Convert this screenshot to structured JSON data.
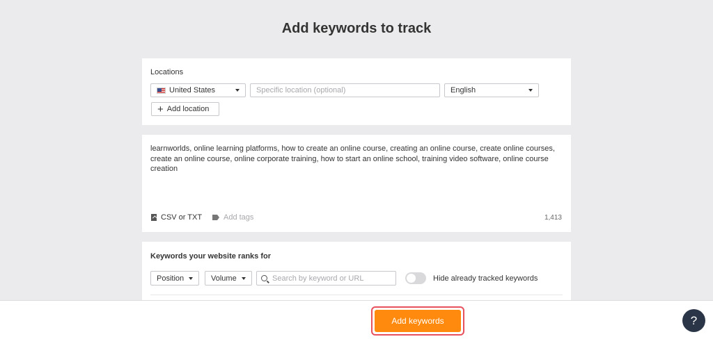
{
  "title": "Add keywords to track",
  "locations": {
    "label": "Locations",
    "country": "United States",
    "specific_placeholder": "Specific location (optional)",
    "language": "English",
    "add_location": "Add location"
  },
  "keywords": {
    "text": "learnworlds, online learning platforms, how to create an online course, creating an online course, create online courses, create an online course, online corporate training, how to start an online school, training video software, online course creation",
    "csv_label": "CSV or TXT",
    "tags_label": "Add tags",
    "char_count": "1,413"
  },
  "ranks": {
    "title": "Keywords your website ranks for",
    "position_label": "Position",
    "volume_label": "Volume",
    "search_placeholder": "Search by keyword or URL",
    "toggle_label": "Hide already tracked keywords"
  },
  "footer": {
    "add_button": "Add keywords",
    "help": "?"
  },
  "colors": {
    "accent": "#ff8a0d",
    "highlight": "#e8505b",
    "help_bg": "#2a3547"
  }
}
